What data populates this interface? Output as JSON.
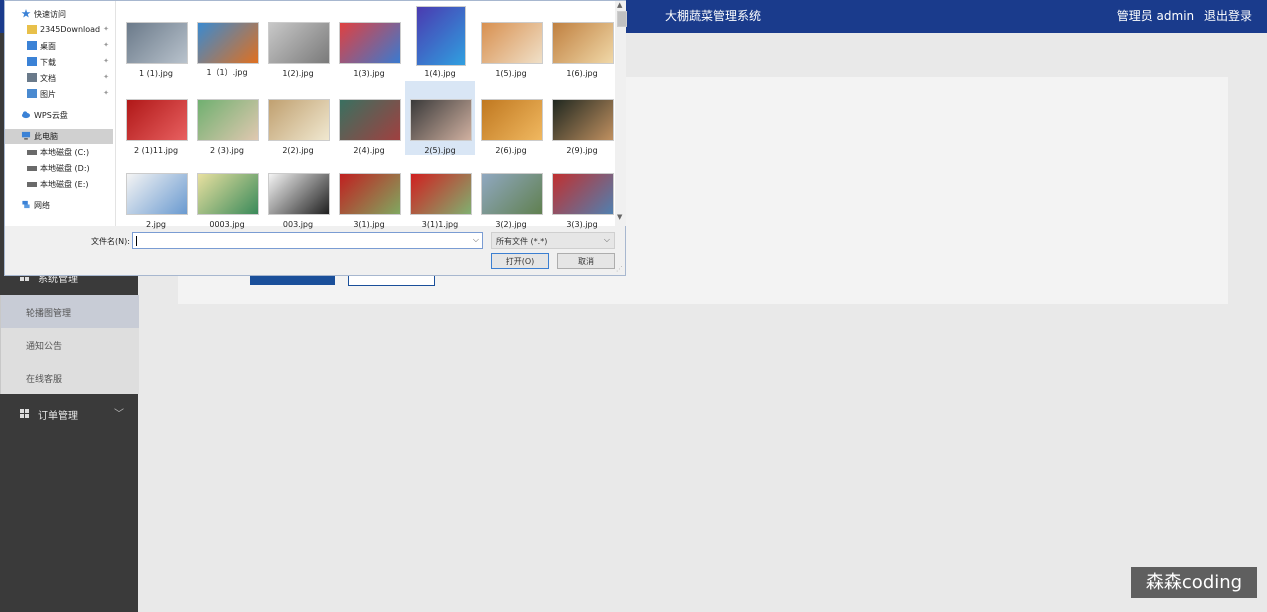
{
  "app": {
    "title": "大棚蔬菜管理系统",
    "user_label": "管理员 admin",
    "logout_label": "退出登录"
  },
  "sidebar": {
    "group_system": "系统管理",
    "submenu": [
      {
        "label": "轮播图管理",
        "active": true
      },
      {
        "label": "通知公告",
        "active": false
      },
      {
        "label": "在线客服",
        "active": false
      }
    ],
    "group_orders": "订单管理",
    "chevron": "﹀"
  },
  "dialog": {
    "nav": {
      "quick_access": "快速访问",
      "items": [
        {
          "label": "2345Download",
          "icon": "folder-icon",
          "pinned": true
        },
        {
          "label": "桌面",
          "icon": "desktop-icon",
          "pinned": true
        },
        {
          "label": "下载",
          "icon": "download-icon",
          "pinned": true
        },
        {
          "label": "文档",
          "icon": "document-icon",
          "pinned": true
        },
        {
          "label": "图片",
          "icon": "pictures-icon",
          "pinned": true
        }
      ],
      "wps": "WPS云盘",
      "this_pc": "此电脑",
      "drives": [
        "本地磁盘 (C:)",
        "本地磁盘 (D:)",
        "本地磁盘 (E:)"
      ],
      "network": "网络"
    },
    "files": [
      {
        "name": "1 (1).jpg",
        "colors": [
          "#6b7a8a",
          "#b8c2cc"
        ]
      },
      {
        "name": "1（1）.jpg",
        "colors": [
          "#3a8ad0",
          "#e07020"
        ]
      },
      {
        "name": "1(2).jpg",
        "colors": [
          "#c8c8c8",
          "#7a7a7a"
        ]
      },
      {
        "name": "1(3).jpg",
        "colors": [
          "#e04040",
          "#3a7ad0"
        ]
      },
      {
        "name": "1(4).jpg",
        "colors": [
          "#4a3ab0",
          "#30a0e0"
        ]
      },
      {
        "name": "1(5).jpg",
        "colors": [
          "#d89050",
          "#f0e0c8"
        ]
      },
      {
        "name": "1(6).jpg",
        "colors": [
          "#c08040",
          "#f0d8a8"
        ]
      },
      {
        "name": "2 (1)11.jpg",
        "colors": [
          "#b01818",
          "#e86060"
        ]
      },
      {
        "name": "2 (3).jpg",
        "colors": [
          "#70b070",
          "#e0c8b0"
        ]
      },
      {
        "name": "2(2).jpg",
        "colors": [
          "#c0a070",
          "#f0e8d0"
        ]
      },
      {
        "name": "2(4).jpg",
        "colors": [
          "#3a7060",
          "#a04040"
        ]
      },
      {
        "name": "2(5).jpg",
        "colors": [
          "#3a3a3a",
          "#d0b0a0"
        ]
      },
      {
        "name": "2(6).jpg",
        "colors": [
          "#c07820",
          "#f0b860"
        ]
      },
      {
        "name": "2(9).jpg",
        "colors": [
          "#202820",
          "#c09060"
        ]
      },
      {
        "name": "2.jpg",
        "colors": [
          "#f4f4f4",
          "#6a9ad0"
        ]
      },
      {
        "name": "0003.jpg",
        "colors": [
          "#e8e0a0",
          "#3a8a5a"
        ]
      },
      {
        "name": "003.jpg",
        "colors": [
          "#f4f4f4",
          "#202020"
        ]
      },
      {
        "name": "3(1).jpg",
        "colors": [
          "#c02020",
          "#80a860"
        ]
      },
      {
        "name": "3(1)1.jpg",
        "colors": [
          "#d02020",
          "#80b070"
        ]
      },
      {
        "name": "3(2).jpg",
        "colors": [
          "#90a8c0",
          "#608050"
        ]
      },
      {
        "name": "3(3).jpg",
        "colors": [
          "#c03030",
          "#5080b0"
        ]
      }
    ],
    "selected_file": "2(5).jpg",
    "filename_label": "文件名(N):",
    "filename_value": "",
    "filter_value": "所有文件 (*.*)",
    "open_label": "打开(O)",
    "cancel_label": "取消"
  },
  "watermark": "森森coding"
}
